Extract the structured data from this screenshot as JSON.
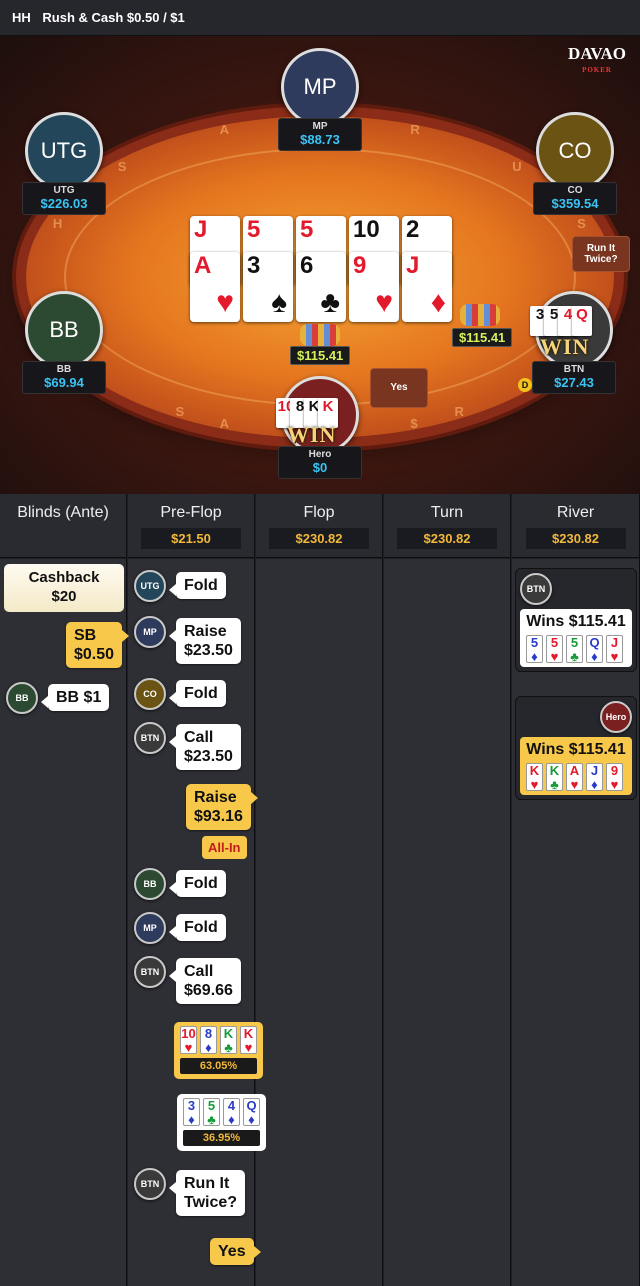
{
  "header": {
    "badge": "HH",
    "title": "Rush & Cash $0.50 / $1"
  },
  "brand": {
    "name": "DAVAO",
    "sub": "POKER"
  },
  "rail_letters": [
    "H",
    "S",
    "A",
    "R",
    "U",
    "S",
    "H",
    "$",
    "U",
    "S",
    "$",
    "A",
    "R",
    "$"
  ],
  "seats": [
    {
      "id": "mp",
      "label": "MP",
      "name": "MP",
      "stack": "$88.73",
      "color": "#2f3b5c"
    },
    {
      "id": "utg",
      "label": "UTG",
      "name": "UTG",
      "stack": "$226.03",
      "color": "#23465a"
    },
    {
      "id": "co",
      "label": "CO",
      "name": "CO",
      "stack": "$359.54",
      "color": "#6b5314"
    },
    {
      "id": "bb",
      "label": "BB",
      "name": "BB",
      "stack": "$69.94",
      "color": "#2c4a32"
    },
    {
      "id": "btn",
      "label": "",
      "name": "BTN",
      "stack": "$27.43",
      "color": "#3a3a3a"
    },
    {
      "id": "hero",
      "label": "",
      "name": "Hero",
      "stack": "$0",
      "color": "#7a2020"
    }
  ],
  "board_top": [
    {
      "rank": "J",
      "suit": "♥",
      "color": "red"
    },
    {
      "rank": "5",
      "suit": "♥",
      "color": "red"
    },
    {
      "rank": "5",
      "suit": "♦",
      "color": "red"
    },
    {
      "rank": "10",
      "suit": "♣",
      "color": "blk"
    },
    {
      "rank": "2",
      "suit": "♠",
      "color": "blk"
    }
  ],
  "board_bottom": [
    {
      "rank": "A",
      "suit": "♥",
      "color": "red"
    },
    {
      "rank": "3",
      "suit": "♠",
      "color": "blk"
    },
    {
      "rank": "6",
      "suit": "♣",
      "color": "blk"
    },
    {
      "rank": "9",
      "suit": "♥",
      "color": "red"
    },
    {
      "rank": "J",
      "suit": "♦",
      "color": "red"
    }
  ],
  "pots": {
    "left": "$115.41",
    "right": "$115.41"
  },
  "run_it_twice_button": "Run It Twice?",
  "yes_button": "Yes",
  "dealer": "D",
  "win_text": "WIN",
  "btn_hole": [
    "3",
    "5",
    "4",
    "Q"
  ],
  "hero_hole": [
    "10",
    "8",
    "K",
    "K"
  ],
  "columns": [
    {
      "title": "Blinds (Ante)",
      "pot": ""
    },
    {
      "title": "Pre-Flop",
      "pot": "$21.50"
    },
    {
      "title": "Flop",
      "pot": "$230.82"
    },
    {
      "title": "Turn",
      "pot": "$230.82"
    },
    {
      "title": "River",
      "pot": "$230.82"
    }
  ],
  "blinds": {
    "cashback_line1": "Cashback",
    "cashback_line2": "$20",
    "sb_line1": "SB",
    "sb_line2": "$0.50",
    "bb_badge": "BB",
    "bb_text": "BB $1"
  },
  "preflop": [
    {
      "badge": "UTG",
      "badge_color": "#23465a",
      "line1": "Fold",
      "line2": ""
    },
    {
      "badge": "MP",
      "badge_color": "#2f3b5c",
      "line1": "Raise",
      "line2": "$23.50"
    },
    {
      "badge": "CO",
      "badge_color": "#6b5314",
      "line1": "Fold",
      "line2": ""
    },
    {
      "badge": "BTN",
      "badge_color": "#3a3a3a",
      "line1": "Call",
      "line2": "$23.50"
    },
    {
      "badge": "BB",
      "badge_color": "#2c4a32",
      "line1": "Fold",
      "line2": ""
    },
    {
      "badge": "MP",
      "badge_color": "#2f3b5c",
      "line1": "Fold",
      "line2": ""
    },
    {
      "badge": "BTN",
      "badge_color": "#3a3a3a",
      "line1": "Call",
      "line2": "$69.66"
    },
    {
      "badge": "BTN",
      "badge_color": "#3a3a3a",
      "line1": "Run It",
      "line2": "Twice?"
    }
  ],
  "hero_raise": {
    "line1": "Raise",
    "line2": "$93.16",
    "allin": "All-In"
  },
  "hero_equity": {
    "cards": [
      {
        "r": "10",
        "s": "♥",
        "c": "red"
      },
      {
        "r": "8",
        "s": "♦",
        "c": "blu"
      },
      {
        "r": "K",
        "s": "♣",
        "c": "grn"
      },
      {
        "r": "K",
        "s": "♥",
        "c": "red"
      }
    ],
    "pct": "63.05%"
  },
  "btn_equity": {
    "cards": [
      {
        "r": "3",
        "s": "♦",
        "c": "blu"
      },
      {
        "r": "5",
        "s": "♣",
        "c": "grn"
      },
      {
        "r": "4",
        "s": "♦",
        "c": "blu"
      },
      {
        "r": "Q",
        "s": "♦",
        "c": "blu"
      }
    ],
    "pct": "36.95%"
  },
  "hero_yes": "Yes",
  "river": {
    "btn_badge": "BTN",
    "btn_wins": "Wins $115.41",
    "btn_cards": [
      {
        "r": "5",
        "s": "♦",
        "c": "blu"
      },
      {
        "r": "5",
        "s": "♥",
        "c": "red"
      },
      {
        "r": "5",
        "s": "♣",
        "c": "grn"
      },
      {
        "r": "Q",
        "s": "♦",
        "c": "blu"
      },
      {
        "r": "J",
        "s": "♥",
        "c": "red"
      }
    ],
    "hero_badge": "Hero",
    "hero_wins": "Wins $115.41",
    "hero_cards": [
      {
        "r": "K",
        "s": "♥",
        "c": "red"
      },
      {
        "r": "K",
        "s": "♣",
        "c": "grn"
      },
      {
        "r": "A",
        "s": "♥",
        "c": "red"
      },
      {
        "r": "J",
        "s": "♦",
        "c": "blu"
      },
      {
        "r": "9",
        "s": "♥",
        "c": "red"
      }
    ]
  }
}
